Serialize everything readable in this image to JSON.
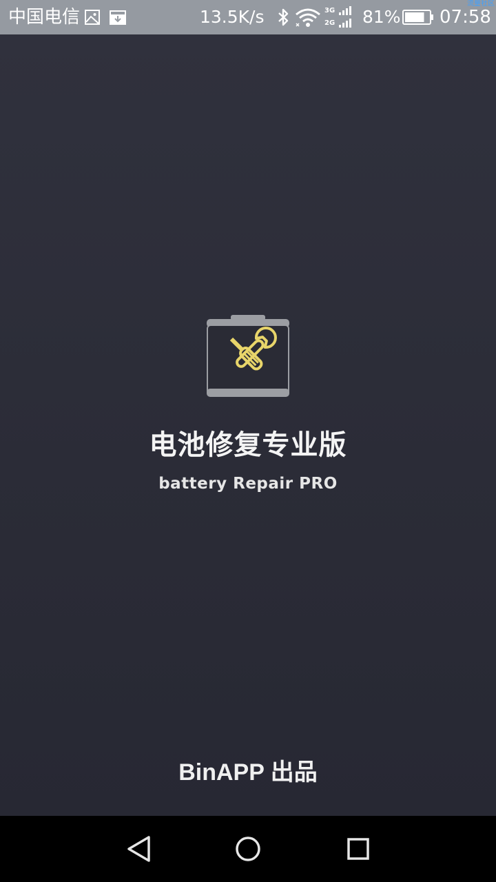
{
  "status_bar": {
    "carrier": "中国电信",
    "net_speed": "13.5K/s",
    "network_types": [
      "3G",
      "2G"
    ],
    "battery_percent": "81%",
    "battery_level": 0.81,
    "time": "07:58",
    "watermark": "流量社区",
    "icons": [
      "gallery-icon",
      "download-notification-icon",
      "bluetooth-icon",
      "wifi-icon",
      "signal-icon",
      "battery-icon"
    ]
  },
  "splash": {
    "title": "电池修复专业版",
    "subtitle": "battery Repair PRO",
    "publisher": "BinAPP 出品",
    "logo_icon": "battery-repair-tools-icon",
    "colors": {
      "background": "#2c2d38",
      "accent": "#e8d56a",
      "battery_frame": "#9c9ea3"
    }
  },
  "nav_bar": {
    "buttons": [
      "back-icon",
      "home-icon",
      "recents-icon"
    ]
  }
}
